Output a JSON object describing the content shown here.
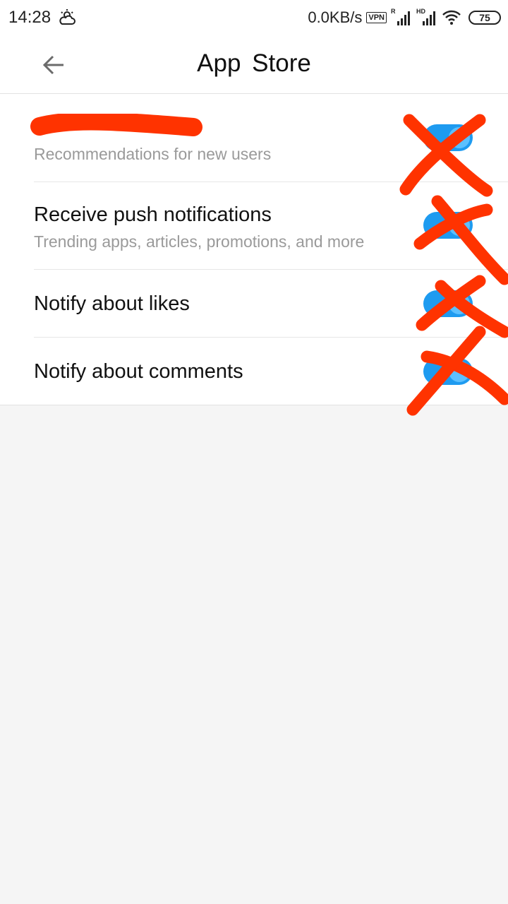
{
  "status_bar": {
    "time": "14:28",
    "weather_icon": "cloud-sun-icon",
    "net_speed": "0.0KB/s",
    "vpn_label": "VPN",
    "signal_1_tag": "R",
    "signal_2_tag": "HD",
    "battery_level": "75"
  },
  "app_bar": {
    "back_icon": "arrow-left-icon",
    "title": "App  Store"
  },
  "settings": [
    {
      "title": "",
      "subtitle": "Recommendations for new users",
      "enabled": true,
      "title_redacted": true
    },
    {
      "title": "Receive push notifications",
      "subtitle": "Trending apps, articles, promotions, and more",
      "enabled": true
    },
    {
      "title": "Notify about likes",
      "enabled": true
    },
    {
      "title": "Notify about comments",
      "enabled": true
    }
  ],
  "colors": {
    "toggle_on": "#1e9bf0",
    "annotation_red": "#ff3300",
    "background": "#f5f5f5"
  }
}
